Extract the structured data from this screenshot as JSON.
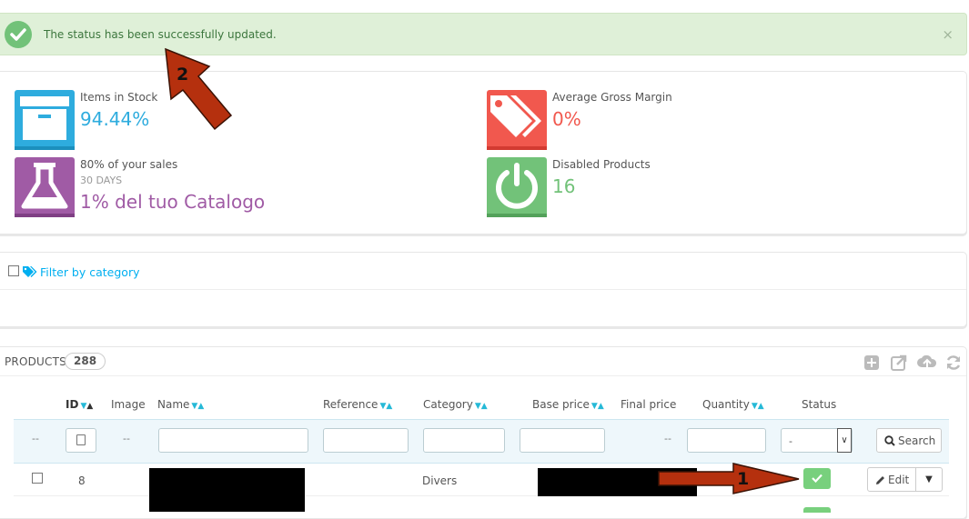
{
  "alert": {
    "message": "The status has been successfully updated.",
    "close": "×",
    "color": "#dff0d8"
  },
  "kpis": [
    {
      "icon": "archive-box-icon",
      "label": "Items in Stock",
      "sub": "",
      "value": "94.44%",
      "color": "#2eacde",
      "value_color": "#2eacde"
    },
    {
      "icon": "price-tags-icon",
      "label": "Average Gross Margin",
      "sub": "",
      "value": "0%",
      "color": "#f1584e",
      "value_color": "#f1584e"
    },
    {
      "icon": "flask-icon",
      "label": "80% of your sales",
      "sub": "30 DAYS",
      "value": "1% del tuo Catalogo",
      "color": "#a05ba5",
      "value_color": "#a05ba5"
    },
    {
      "icon": "power-icon",
      "label": "Disabled Products",
      "sub": "",
      "value": "16",
      "color": "#72c279",
      "value_color": "#72c279"
    }
  ],
  "filter_category": {
    "label": "Filter by category",
    "icon": "tags-icon"
  },
  "products": {
    "title": "PRODUCTS",
    "count": "288",
    "toolbar": [
      "add-icon",
      "export-icon",
      "import-icon",
      "refresh-icon"
    ],
    "columns": {
      "id": "ID",
      "image": "Image",
      "name": "Name",
      "reference": "Reference",
      "category": "Category",
      "base_price": "Base price",
      "final_price": "Final price",
      "quantity": "Quantity",
      "status": "Status"
    },
    "filter_row": {
      "dash": "--",
      "image_dash": "--",
      "final_price_dash": "--",
      "status_select": "-",
      "search_label": "Search"
    },
    "rows": [
      {
        "id": "8",
        "category": "Divers",
        "status": "enabled",
        "edit_label": "Edit"
      }
    ]
  },
  "annotations": [
    {
      "number": "1",
      "color": "#b5300e"
    },
    {
      "number": "2",
      "color": "#b5300e"
    }
  ]
}
